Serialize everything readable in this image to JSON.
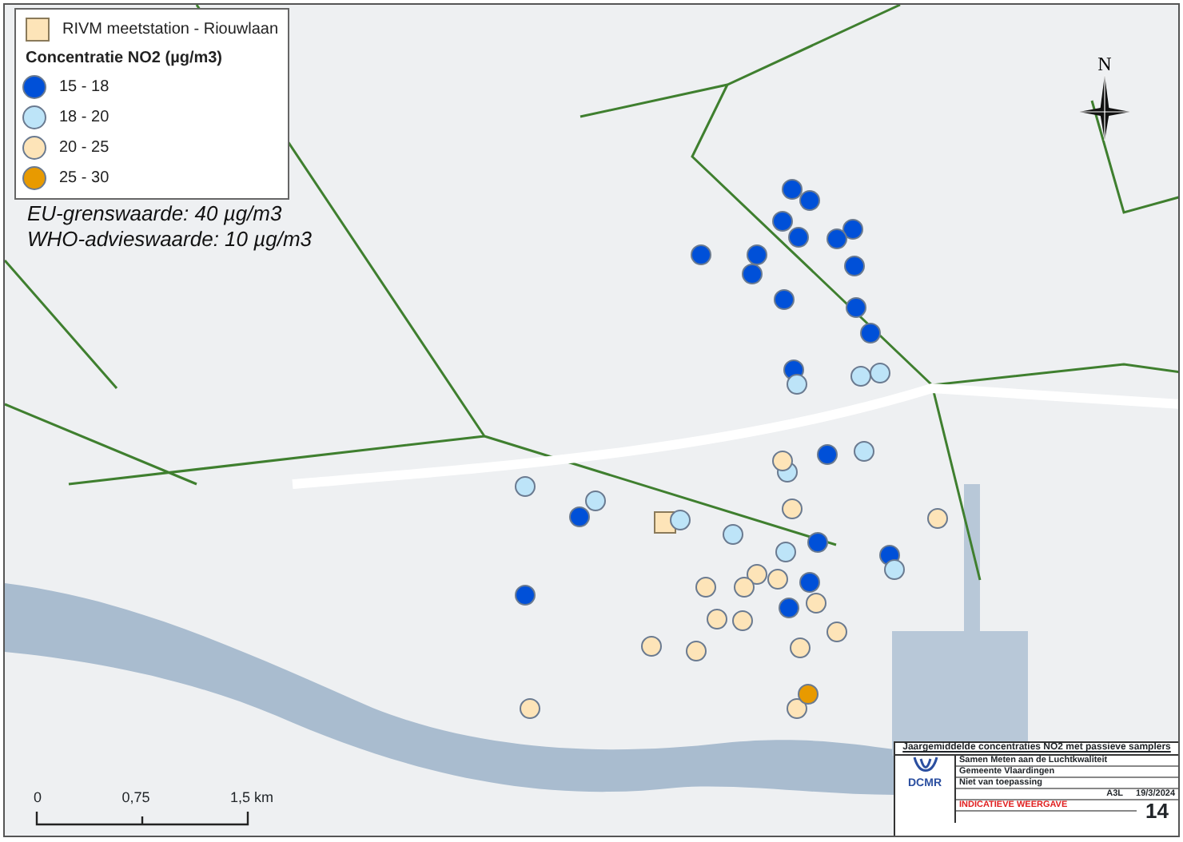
{
  "legend": {
    "station": {
      "label": "RIVM meetstation - Riouwlaan",
      "color": "#fde4b8"
    },
    "heading": "Concentratie NO2 (µg/m3)",
    "classes": [
      {
        "label": "15 - 18",
        "color": "#0050d8"
      },
      {
        "label": "18 - 20",
        "color": "#bde4f8"
      },
      {
        "label": "20 - 25",
        "color": "#fde4b8"
      },
      {
        "label": "25 - 30",
        "color": "#e89a00"
      }
    ]
  },
  "norms": [
    "EU-grenswaarde: 40 µg/m3",
    "WHO-advieswaarde: 10 µg/m3"
  ],
  "north": "N",
  "scale_bar": {
    "labels": [
      "0",
      "0,75",
      "1,5 km"
    ]
  },
  "samplers": [
    {
      "color": "#0050d8"
    },
    {
      "color": "#0050d8"
    },
    {
      "color": "#0050d8"
    },
    {
      "color": "#0050d8"
    },
    {
      "color": "#0050d8"
    },
    {
      "color": "#0050d8"
    },
    {
      "color": "#0050d8"
    },
    {
      "color": "#0050d8"
    },
    {
      "color": "#0050d8"
    },
    {
      "color": "#0050d8"
    },
    {
      "color": "#0050d8"
    },
    {
      "color": "#0050d8"
    },
    {
      "color": "#0050d8"
    },
    {
      "color": "#0050d8"
    },
    {
      "color": "#0050d8"
    },
    {
      "color": "#0050d8"
    },
    {
      "color": "#0050d8"
    },
    {
      "color": "#0050d8"
    },
    {
      "color": "#0050d8"
    },
    {
      "color": "#0050d8"
    },
    {
      "color": "#0050d8"
    },
    {
      "color": "#bde4f8"
    },
    {
      "color": "#bde4f8"
    },
    {
      "color": "#bde4f8"
    },
    {
      "color": "#bde4f8"
    },
    {
      "color": "#bde4f8"
    },
    {
      "color": "#bde4f8"
    },
    {
      "color": "#bde4f8"
    },
    {
      "color": "#bde4f8"
    },
    {
      "color": "#bde4f8"
    },
    {
      "color": "#bde4f8"
    },
    {
      "color": "#bde4f8"
    },
    {
      "color": "#fde4b8"
    },
    {
      "color": "#fde4b8"
    },
    {
      "color": "#fde4b8"
    },
    {
      "color": "#fde4b8"
    },
    {
      "color": "#fde4b8"
    },
    {
      "color": "#fde4b8"
    },
    {
      "color": "#fde4b8"
    },
    {
      "color": "#fde4b8"
    },
    {
      "color": "#fde4b8"
    },
    {
      "color": "#fde4b8"
    },
    {
      "color": "#fde4b8"
    },
    {
      "color": "#fde4b8"
    },
    {
      "color": "#fde4b8"
    },
    {
      "color": "#fde4b8"
    },
    {
      "color": "#fde4b8"
    },
    {
      "color": "#fde4b8"
    },
    {
      "color": "#e89a00"
    }
  ],
  "title_block": {
    "title": "Jaargemiddelde concentraties NO2 met passieve samplers",
    "logo": "DCMR",
    "project": "Samen Meten aan de Luchtkwaliteit",
    "municipality": "Gemeente Vlaardingen",
    "subject": "Niet van toepassing",
    "format": "A3L",
    "date": "19/3/2024",
    "status": "INDICATIEVE WEERGAVE",
    "sheet": "14"
  }
}
